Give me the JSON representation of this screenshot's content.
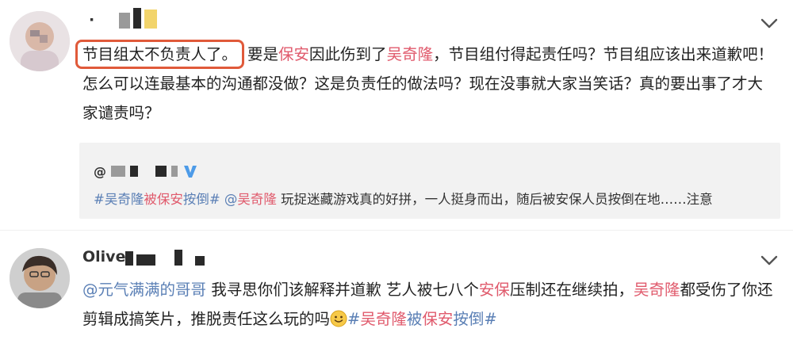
{
  "comments": [
    {
      "username": "·",
      "text": {
        "highlighted": "节目组太不负责人了。",
        "p1": "要是",
        "r1": "保安",
        "p2": "因此伤到了",
        "r2": "吴奇隆",
        "p3": "，节目组付得起责任吗？节目组应该出来道歉吧！怎么可以连最基本的沟通都没做？这是负责任的做法吗？现在没事就大家当笑话？真的要出事了才大家谴责吗？"
      },
      "repost": {
        "user_prefix": "@",
        "text_t1": "#吴奇隆",
        "text_t2": "被",
        "text_t3": "保安",
        "text_t4": "按倒#",
        "text_m1": "@",
        "text_m2": "吴奇隆",
        "text_rest": " 玩捉迷藏游戏真的好拼，一人挺身而出，随后被安保人员按倒在地……注意"
      }
    },
    {
      "username": "Olive",
      "text": {
        "m1": "@元气满满的哥哥",
        "p1": " 我寻思你们该解释并道歉 艺人被七八个",
        "r1": "安保",
        "p2": "压制还在继续拍，",
        "r2": "吴奇隆",
        "p3": "都受伤了你还剪辑成搞笑片，推脱责任这么玩的吗",
        "t1": "#",
        "t2": "吴奇隆",
        "t3": "被",
        "t4": "保安",
        "t5": "按倒#"
      }
    }
  ],
  "icons": {
    "menu": "chevron-down-icon",
    "verified": "verified-v-icon",
    "emoji": "smile-emoji-icon"
  },
  "colors": {
    "keyword_red": "#e05a6c",
    "link_blue": "#5a7fb5",
    "highlight_box": "#e05a3a",
    "repost_bg": "#f2f2f2"
  }
}
